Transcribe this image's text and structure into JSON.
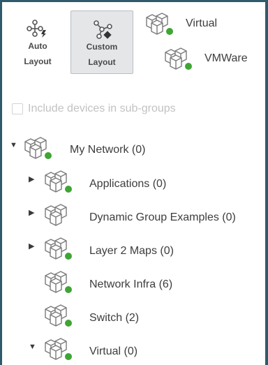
{
  "toolbar": {
    "auto_layout": {
      "line1": "Auto",
      "line2": "Layout"
    },
    "custom_layout": {
      "line1": "Custom",
      "line2": "Layout"
    }
  },
  "top_devices": [
    {
      "label": "Virtual",
      "status_color": "#3fa535"
    },
    {
      "label": "VMWare",
      "status_color": "#3fa535"
    }
  ],
  "include_subgroups": {
    "label": "Include devices in sub-groups",
    "checked": false
  },
  "tree": {
    "root": {
      "label": "My Network (0)",
      "expanded": true,
      "status": "online"
    },
    "children": [
      {
        "label": "Applications (0)",
        "status": "online",
        "expandable": true,
        "expanded": false
      },
      {
        "label": "Dynamic Group Examples (0)",
        "status": "none",
        "expandable": true,
        "expanded": false
      },
      {
        "label": "Layer 2 Maps (0)",
        "status": "online",
        "expandable": true,
        "expanded": false
      },
      {
        "label": "Network Infra (6)",
        "status": "online",
        "expandable": false
      },
      {
        "label": "Switch (2)",
        "status": "online",
        "expandable": false
      },
      {
        "label": "Virtual (0)",
        "status": "online",
        "expandable": true,
        "expanded": true
      }
    ]
  },
  "colors": {
    "status_online": "#3fa535",
    "background": "#2f5a6c"
  }
}
